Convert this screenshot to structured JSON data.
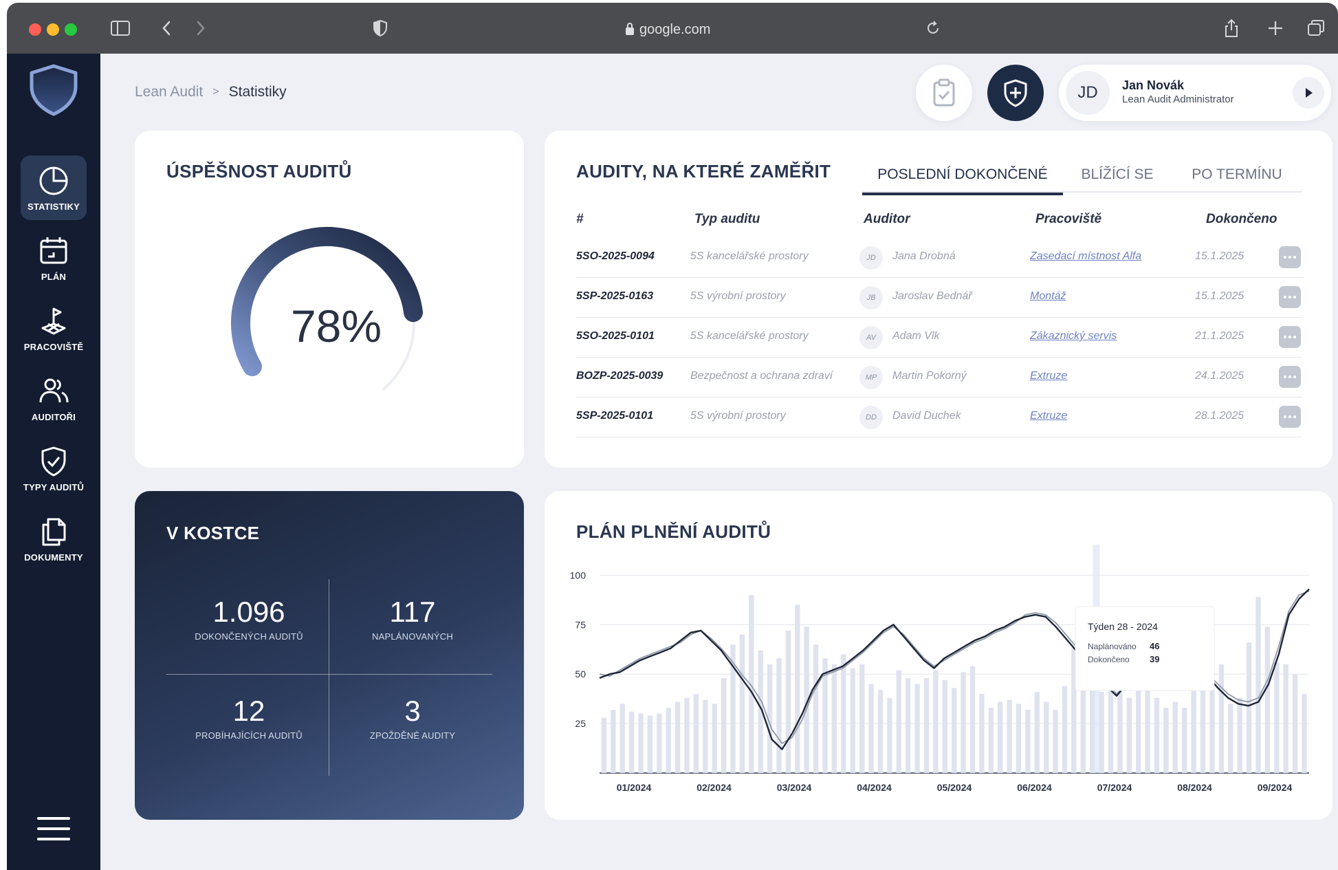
{
  "browser": {
    "url": "google.com"
  },
  "sidebar": {
    "items": [
      {
        "label": "STATISTIKY"
      },
      {
        "label": "PLÁN"
      },
      {
        "label": "PRACOVIŠTĚ"
      },
      {
        "label": "AUDITOŘI"
      },
      {
        "label": "TYPY AUDITŮ"
      },
      {
        "label": "DOKUMENTY"
      }
    ]
  },
  "breadcrumb": {
    "parent": "Lean Audit",
    "separator": ">",
    "current": "Statistiky"
  },
  "user": {
    "initials": "JD",
    "name": "Jan Novák",
    "role": "Lean Audit Administrator"
  },
  "gauge": {
    "title": "ÚSPĚŠNOST AUDITŮ",
    "value_text": "78%",
    "value": 0.78
  },
  "audits": {
    "title": "AUDITY, NA KTERÉ ZAMĚŘIT",
    "tabs": [
      "POSLEDNÍ DOKONČENÉ",
      "BLÍŽÍCÍ SE",
      "PO TERMÍNU"
    ],
    "active_tab": 0,
    "headers": [
      "#",
      "Typ auditu",
      "Auditor",
      "Pracoviště",
      "Dokončeno"
    ],
    "rows": [
      {
        "id": "5SO-2025-0094",
        "type": "5S kancelářské prostory",
        "initials": "JD",
        "auditor": "Jana Drobná",
        "place": "Zasedací místnost Alfa",
        "date": "15.1.2025"
      },
      {
        "id": "5SP-2025-0163",
        "type": "5S výrobní prostory",
        "initials": "JB",
        "auditor": "Jaroslav Bednář",
        "place": "Montáž",
        "date": "15.1.2025"
      },
      {
        "id": "5SO-2025-0101",
        "type": "5S kancelářské prostory",
        "initials": "AV",
        "auditor": "Adam Vlk",
        "place": "Zákaznický servis",
        "date": "21.1.2025"
      },
      {
        "id": "BOZP-2025-0039",
        "type": "Bezpečnost a ochrana zdraví",
        "initials": "MP",
        "auditor": "Martin Pokorný",
        "place": "Extruze",
        "date": "24.1.2025"
      },
      {
        "id": "5SP-2025-0101",
        "type": "5S výrobní prostory",
        "initials": "DD",
        "auditor": "David Duchek",
        "place": "Extruze",
        "date": "28.1.2025"
      }
    ]
  },
  "summary": {
    "title": "V KOSTCE",
    "stats": [
      {
        "value": "1.096",
        "label": "DOKONČENÝCH AUDITŮ"
      },
      {
        "value": "117",
        "label": "NAPLÁNOVANÝCH"
      },
      {
        "value": "12",
        "label": "PROBÍHAJÍCÍCH AUDITŮ"
      },
      {
        "value": "3",
        "label": "ZPOŽDĚNÉ AUDITY"
      }
    ]
  },
  "chart_data": {
    "type": "line",
    "title": "PLÁN PLNĚNÍ AUDITŮ",
    "yticks": [
      25,
      50,
      75,
      100
    ],
    "ylim": [
      0,
      105
    ],
    "xticks": [
      "01/2024",
      "02/2024",
      "03/2024",
      "04/2024",
      "05/2024",
      "06/2024",
      "07/2024",
      "08/2024",
      "09/2024"
    ],
    "weeks": 44,
    "series": [
      {
        "name": "Naplánováno",
        "color": "#8f97a8",
        "values": [
          50,
          49,
          52,
          55,
          58,
          60,
          62,
          64,
          66,
          70,
          72,
          68,
          63,
          57,
          50,
          44,
          36,
          22,
          15,
          18,
          27,
          40,
          49,
          51,
          53,
          57,
          61,
          66,
          71,
          74,
          70,
          64,
          58,
          54,
          57,
          60,
          63,
          66,
          68,
          71,
          73,
          76,
          80,
          81,
          80,
          76,
          70,
          64,
          57,
          50,
          46,
          40,
          44,
          47,
          52,
          56,
          60,
          61,
          58,
          55,
          50,
          45,
          40,
          37,
          36,
          38,
          48,
          64,
          82,
          90,
          92
        ]
      },
      {
        "name": "Dokončeno",
        "color": "#1e2536",
        "values": [
          48,
          50,
          51,
          54,
          57,
          59,
          61,
          63,
          67,
          71,
          72,
          67,
          62,
          55,
          48,
          41,
          32,
          17,
          12,
          20,
          30,
          42,
          50,
          52,
          54,
          58,
          62,
          67,
          72,
          75,
          69,
          63,
          57,
          53,
          58,
          61,
          64,
          67,
          69,
          72,
          74,
          77,
          79,
          80,
          79,
          74,
          68,
          62,
          55,
          48,
          44,
          39,
          45,
          48,
          53,
          57,
          59,
          60,
          57,
          54,
          49,
          43,
          38,
          35,
          34,
          36,
          45,
          60,
          80,
          88,
          93
        ]
      }
    ],
    "bars": [
      28,
      32,
      35,
      31,
      30,
      29,
      30,
      33,
      36,
      38,
      40,
      37,
      35,
      48,
      65,
      70,
      90,
      62,
      55,
      58,
      72,
      85,
      74,
      65,
      58,
      55,
      60,
      53,
      55,
      45,
      42,
      38,
      52,
      48,
      45,
      48,
      52,
      47,
      43,
      51,
      54,
      40,
      33,
      36,
      37,
      35,
      32,
      41,
      36,
      32,
      44,
      63,
      57,
      54,
      41,
      48,
      44,
      38,
      48,
      44,
      38,
      33,
      36,
      33,
      46,
      43,
      71,
      55,
      35,
      38,
      66,
      89,
      74,
      56,
      55,
      50,
      40
    ],
    "tooltip": {
      "title": "Týden 28 - 2024",
      "rows": [
        {
          "label": "Naplánováno",
          "value": "46"
        },
        {
          "label": "Dokončeno",
          "value": "39"
        }
      ]
    }
  }
}
